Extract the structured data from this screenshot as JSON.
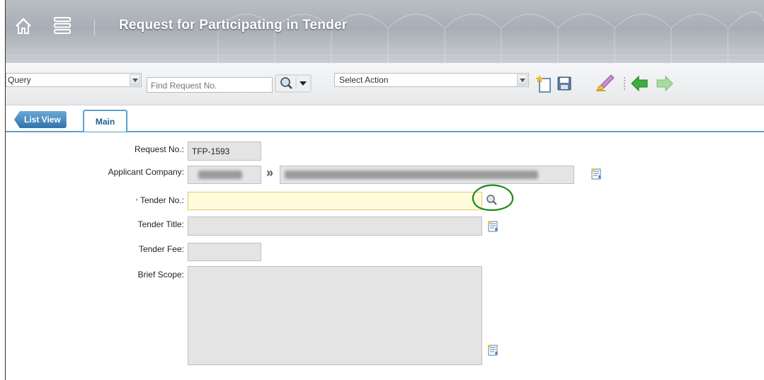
{
  "header": {
    "title": "Request for Participating in Tender",
    "home_icon": "home-icon",
    "menu_icon": "menu-icon"
  },
  "toolbar": {
    "query_value": "Query",
    "find_placeholder": "Find Request No.",
    "search_icon": "search-icon",
    "action_value": "Select Action",
    "new_icon": "new-document-icon",
    "save_icon": "save-icon",
    "clear_icon": "clear-icon",
    "back_icon": "back-arrow-icon",
    "forward_icon": "forward-arrow-icon"
  },
  "tabs": {
    "list_view": "List View",
    "main": "Main"
  },
  "form": {
    "request_no_label": "Request No.:",
    "request_no_value": "TFP-1593",
    "applicant_company_label": "Applicant Company:",
    "tender_no_required_mark": "*",
    "tender_no_label": "Tender No.:",
    "tender_no_value": "",
    "tender_title_label": "Tender Title:",
    "tender_fee_label": "Tender Fee:",
    "brief_scope_label": "Brief Scope:",
    "separator_glyph": "»"
  },
  "colors": {
    "header_bg": "#aeb3b9",
    "tab_accent": "#5aa0d0",
    "required_input_bg": "#fffbdc",
    "readonly_field_bg": "#e4e4e4",
    "annotation_circle": "#1a8a1a"
  }
}
